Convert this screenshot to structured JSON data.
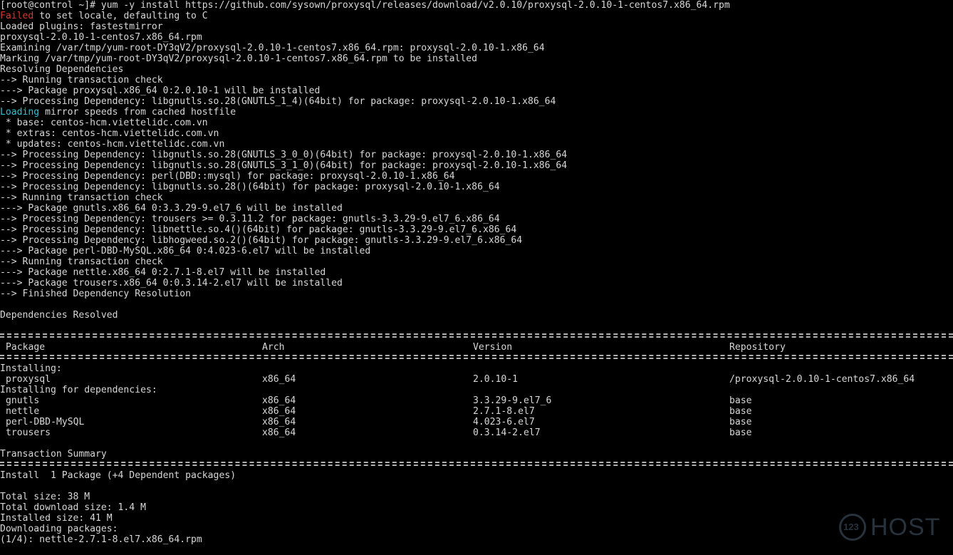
{
  "terminal": {
    "lines": [
      {
        "text": "[root@control ~]# yum -y install https://github.com/sysown/proxysql/releases/download/v2.0.10/proxysql-2.0.10-1-centos7.x86_64.rpm"
      },
      {
        "prefix": "Failed",
        "text": " to set locale, defaulting to C"
      },
      {
        "text": "Loaded plugins: fastestmirror"
      },
      {
        "text": "proxysql-2.0.10-1-centos7.x86_64.rpm"
      },
      {
        "text": "Examining /var/tmp/yum-root-DY3qV2/proxysql-2.0.10-1-centos7.x86_64.rpm: proxysql-2.0.10-1.x86_64"
      },
      {
        "text": "Marking /var/tmp/yum-root-DY3qV2/proxysql-2.0.10-1-centos7.x86_64.rpm to be installed"
      },
      {
        "text": "Resolving Dependencies"
      },
      {
        "text": "--> Running transaction check"
      },
      {
        "text": "---> Package proxysql.x86_64 0:2.0.10-1 will be installed"
      },
      {
        "text": "--> Processing Dependency: libgnutls.so.28(GNUTLS_1_4)(64bit) for package: proxysql-2.0.10-1.x86_64"
      },
      {
        "prefix": "Loading",
        "text": " mirror speeds from cached hostfile"
      },
      {
        "text": " * base: centos-hcm.viettelidc.com.vn"
      },
      {
        "text": " * extras: centos-hcm.viettelidc.com.vn"
      },
      {
        "text": " * updates: centos-hcm.viettelidc.com.vn"
      },
      {
        "text": "--> Processing Dependency: libgnutls.so.28(GNUTLS_3_0_0)(64bit) for package: proxysql-2.0.10-1.x86_64"
      },
      {
        "text": "--> Processing Dependency: libgnutls.so.28(GNUTLS_3_1_0)(64bit) for package: proxysql-2.0.10-1.x86_64"
      },
      {
        "text": "--> Processing Dependency: perl(DBD::mysql) for package: proxysql-2.0.10-1.x86_64"
      },
      {
        "text": "--> Processing Dependency: libgnutls.so.28()(64bit) for package: proxysql-2.0.10-1.x86_64"
      },
      {
        "text": "--> Running transaction check"
      },
      {
        "text": "---> Package gnutls.x86_64 0:3.3.29-9.el7_6 will be installed"
      },
      {
        "text": "--> Processing Dependency: trousers >= 0.3.11.2 for package: gnutls-3.3.29-9.el7_6.x86_64"
      },
      {
        "text": "--> Processing Dependency: libnettle.so.4()(64bit) for package: gnutls-3.3.29-9.el7_6.x86_64"
      },
      {
        "text": "--> Processing Dependency: libhogweed.so.2()(64bit) for package: gnutls-3.3.29-9.el7_6.x86_64"
      },
      {
        "text": "---> Package perl-DBD-MySQL.x86_64 0:4.023-6.el7 will be installed"
      },
      {
        "text": "--> Running transaction check"
      },
      {
        "text": "---> Package nettle.x86_64 0:2.7.1-8.el7 will be installed"
      },
      {
        "text": "---> Package trousers.x86_64 0:0.3.14-2.el7 will be installed"
      },
      {
        "text": "--> Finished Dependency Resolution"
      },
      {
        "text": ""
      },
      {
        "text": "Dependencies Resolved"
      }
    ],
    "table": {
      "headers": {
        "package": "Package",
        "arch": "Arch",
        "version": "Version",
        "repository": "Repository"
      },
      "installing_label": "Installing:",
      "installing": [
        {
          "package": "proxysql",
          "arch": "x86_64",
          "version": "2.0.10-1",
          "repository": "/proxysql-2.0.10-1-centos7.x86_64"
        }
      ],
      "deps_label": "Installing for dependencies:",
      "deps": [
        {
          "package": "gnutls",
          "arch": "x86_64",
          "version": "3.3.29-9.el7_6",
          "repository": "base"
        },
        {
          "package": "nettle",
          "arch": "x86_64",
          "version": "2.7.1-8.el7",
          "repository": "base"
        },
        {
          "package": "perl-DBD-MySQL",
          "arch": "x86_64",
          "version": "4.023-6.el7",
          "repository": "base"
        },
        {
          "package": "trousers",
          "arch": "x86_64",
          "version": "0.3.14-2.el7",
          "repository": "base"
        }
      ]
    },
    "summary": {
      "title": "Transaction Summary",
      "install_line": "Install  1 Package (+4 Dependent packages)",
      "total_size": "Total size: 38 M",
      "download_size": "Total download size: 1.4 M",
      "installed_size": "Installed size: 41 M",
      "downloading": "Downloading packages:",
      "progress": "(1/4): nettle-2.7.1-8.el7.x86_64.rpm"
    }
  },
  "watermark": {
    "logo_number": "123",
    "brand": "HOST"
  },
  "colors": {
    "background": "#000000",
    "text": "#d7d7d7",
    "error": "#e0342f",
    "info": "#2fc3d6"
  }
}
